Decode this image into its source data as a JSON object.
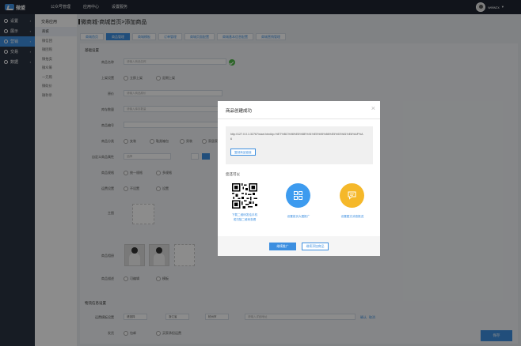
{
  "topbar": {
    "logo_text": "微盟",
    "nav": [
      "公众号管理",
      "应用中心",
      "设置服务"
    ],
    "username": "weiwzx"
  },
  "sidebar": {
    "items": [
      {
        "label": "设置",
        "icon": "gear-icon"
      },
      {
        "label": "展示",
        "icon": "display-icon"
      },
      {
        "label": "营销",
        "icon": "marketing-icon",
        "active": true
      },
      {
        "label": "交易",
        "icon": "trade-icon"
      },
      {
        "label": "数据",
        "icon": "data-icon"
      }
    ]
  },
  "subnav": {
    "header": "交易应用",
    "items": [
      "商城",
      "微信团",
      "微团购",
      "微拍卖",
      "微众筹",
      "一元购",
      "微砍价",
      "微秒杀"
    ]
  },
  "page": {
    "breadcrumb": "微商城-商城首页>添加商品",
    "tabs": [
      "商城首页",
      "商品管理",
      "商城模板",
      "订单管理",
      "商城页面配置",
      "商城基本信息配置",
      "商城营销管理"
    ],
    "section_basic": "基础设置",
    "section_logistics": "物流信息设置",
    "rows": [
      {
        "label": "商品名称",
        "placeholder": "请输入商品名称"
      },
      {
        "label": "上架设置",
        "options": [
          "立即上架",
          "定期上架"
        ]
      },
      {
        "label": "原价",
        "placeholder": "请输入商品原价"
      },
      {
        "label": "库存数量",
        "placeholder": "请输入库存数量"
      },
      {
        "label": "商品编号",
        "placeholder": ""
      },
      {
        "label": "商品分类",
        "options": [
          "女装",
          "鞋类箱包",
          "男装",
          "家居家纺"
        ]
      },
      {
        "label": "自定义商品属性",
        "placeholder": "品牌"
      },
      {
        "label": "商品规格",
        "options": [
          "统一规格",
          "多规格"
        ]
      },
      {
        "label": "运费设置",
        "options": [
          "不设置",
          "设置"
        ]
      },
      {
        "label": "主图"
      },
      {
        "label": "商品相册"
      },
      {
        "label": "商品描述",
        "options": [
          "可编辑",
          "模板"
        ]
      }
    ],
    "logistics_row": {
      "label": "运费模板设置",
      "selects": [
        "请选择",
        "浙江省",
        "杭州市",
        "滨江区"
      ],
      "input_placeholder": "请输入详细地址",
      "links": [
        "确认",
        "取消"
      ]
    },
    "last_row": {
      "label": "发货",
      "options": [
        "包邮",
        "买家承担运费"
      ]
    },
    "save_button": "保存"
  },
  "modal": {
    "title": "商品创建成功",
    "close_glyph": "×",
    "link_text": "http://127.0.0.1:32767/start.html#p=%E7%BC%96%E8%BE%91%E5%95%86%E5%93%81%E8%AF%A6",
    "copy_button": "复制商品链接",
    "also_label": "您还可以",
    "actions": [
      {
        "caption": "下载二维码发给手机\n或扫描二维码查看",
        "icon": "qrcode-icon"
      },
      {
        "caption": "设置首页大图推广",
        "icon": "grid-icon"
      },
      {
        "caption": "设置图文消息推送",
        "icon": "chat-icon"
      }
    ],
    "primary_button": "继续推广",
    "secondary_button": "继续添加商品"
  },
  "colors": {
    "accent": "#3d8fe0",
    "topbar": "#1f2632",
    "sidebar": "#2b3443",
    "success": "#4fb848",
    "warning": "#f5b82a"
  }
}
